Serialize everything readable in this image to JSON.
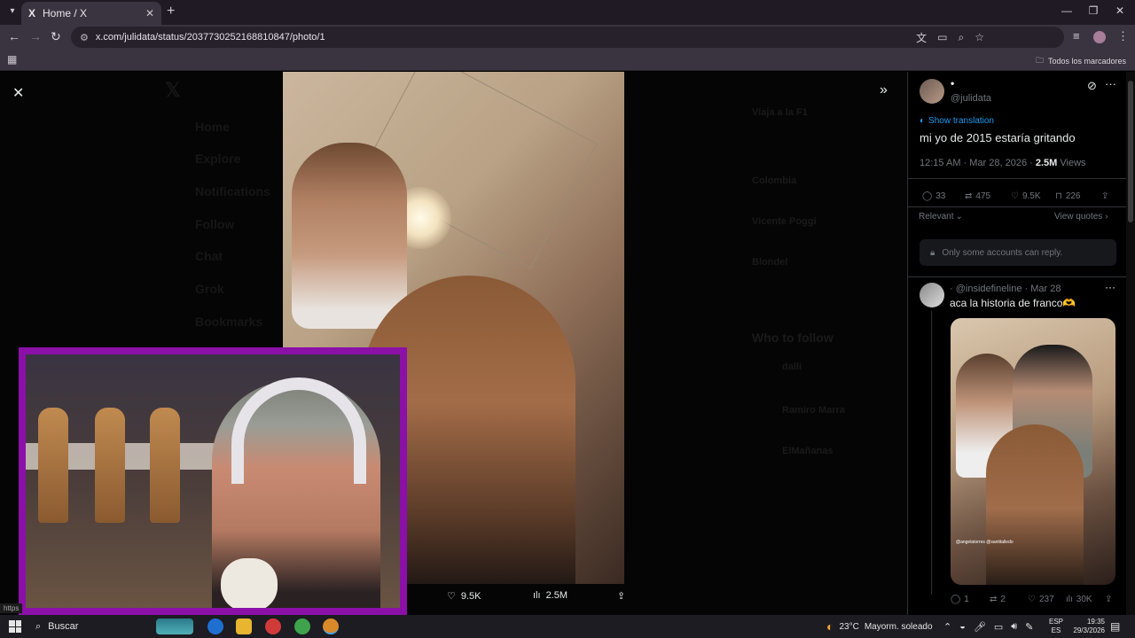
{
  "browser": {
    "tab_title": "Home / X",
    "tab_icon": "X",
    "url": "x.com/julidata/status/2037730252168810847/photo/1",
    "bookmarks_label": "Todos los marcadores",
    "status_url": "https"
  },
  "viewer": {
    "likes": "9.5K",
    "views": "2.5M"
  },
  "background_page": {
    "nav": [
      "Home",
      "Explore",
      "Notifications",
      "Follow",
      "Chat",
      "Grok",
      "Bookmarks"
    ],
    "trends": [
      "Viaja a la F1",
      "Colombia",
      "Vicente Poggi",
      "Blondel"
    ],
    "who_to_follow": "Who to follow",
    "follow_names": [
      "dalli",
      "Ramiro Marra",
      "ElMañanas"
    ]
  },
  "post": {
    "display_name": "•",
    "handle": "@julidata",
    "show_translation": "Show translation",
    "text": "mi yo de 2015 estaría gritando",
    "timestamp": "12:15 AM · Mar 28, 2026 · ",
    "views_count": "2.5M",
    "views_label": " Views",
    "replies": "33",
    "reposts": "475",
    "likes": "9.5K",
    "bookmarks": "226",
    "sort_label": "Relevant",
    "view_quotes": "View quotes",
    "reply_restriction": "Only some accounts can reply."
  },
  "reply": {
    "author": "· @insidefineline · Mar 28",
    "text": "aca la historia de franco🫶",
    "image_tag": "@angelatorres @santitalledo",
    "replies": "1",
    "reposts": "2",
    "likes": "237",
    "views": "30K"
  },
  "taskbar": {
    "search_label": "Buscar",
    "weather_temp": "23°C",
    "weather_desc": "Mayorm. soleado",
    "lang_top": "ESP",
    "lang_bottom": "ES",
    "time": "19:35",
    "date": "29/3/2026"
  },
  "colors": {
    "accent": "#1d9bf0",
    "webcam_border": "#8b10a8",
    "chrome_bg": "#3a3340"
  }
}
